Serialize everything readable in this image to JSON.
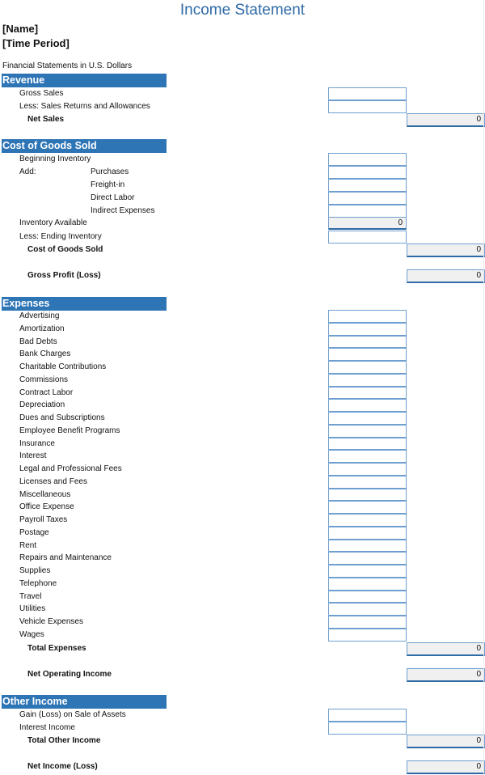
{
  "title": "Income Statement",
  "name_placeholder": "[Name]",
  "period_placeholder": "[Time Period]",
  "currency_note": "Financial Statements in U.S. Dollars",
  "colors": {
    "section_header": "#2e75b6",
    "title": "#2e6aa6",
    "input_border": "#6f9fd0",
    "calc_fill": "#f0f0f0"
  },
  "revenue": {
    "header": "Revenue",
    "gross_sales": "Gross Sales",
    "returns": "Less: Sales Returns and Allowances",
    "net_sales_label": "Net Sales",
    "net_sales_value": "0"
  },
  "cogs": {
    "header": "Cost of Goods Sold",
    "beginning_inventory": "Beginning Inventory",
    "add_label": "Add:",
    "purchases": "Purchases",
    "freight_in": "Freight-in",
    "direct_labor": "Direct Labor",
    "indirect_expenses": "Indirect Expenses",
    "inventory_available_label": "Inventory Available",
    "inventory_available_value": "0",
    "ending_inventory": "Less: Ending Inventory",
    "total_label": "Cost of Goods Sold",
    "total_value": "0"
  },
  "gross_profit": {
    "label": "Gross Profit (Loss)",
    "value": "0"
  },
  "expenses": {
    "header": "Expenses",
    "items": [
      "Advertising",
      "Amortization",
      "Bad Debts",
      "Bank Charges",
      "Charitable Contributions",
      "Commissions",
      "Contract Labor",
      "Depreciation",
      "Dues and Subscriptions",
      "Employee Benefit Programs",
      "Insurance",
      "Interest",
      "Legal and Professional Fees",
      "Licenses and Fees",
      "Miscellaneous",
      "Office Expense",
      "Payroll Taxes",
      "Postage",
      "Rent",
      "Repairs and Maintenance",
      "Supplies",
      "Telephone",
      "Travel",
      "Utilities",
      "Vehicle Expenses",
      "Wages"
    ],
    "total_label": "Total Expenses",
    "total_value": "0"
  },
  "net_operating_income": {
    "label": "Net Operating Income",
    "value": "0"
  },
  "other_income": {
    "header": "Other Income",
    "gain_on_sale": "Gain (Loss) on Sale of Assets",
    "interest_income": "Interest Income",
    "total_label": "Total Other Income",
    "total_value": "0"
  },
  "net_income": {
    "label": "Net Income (Loss)",
    "value": "0"
  }
}
